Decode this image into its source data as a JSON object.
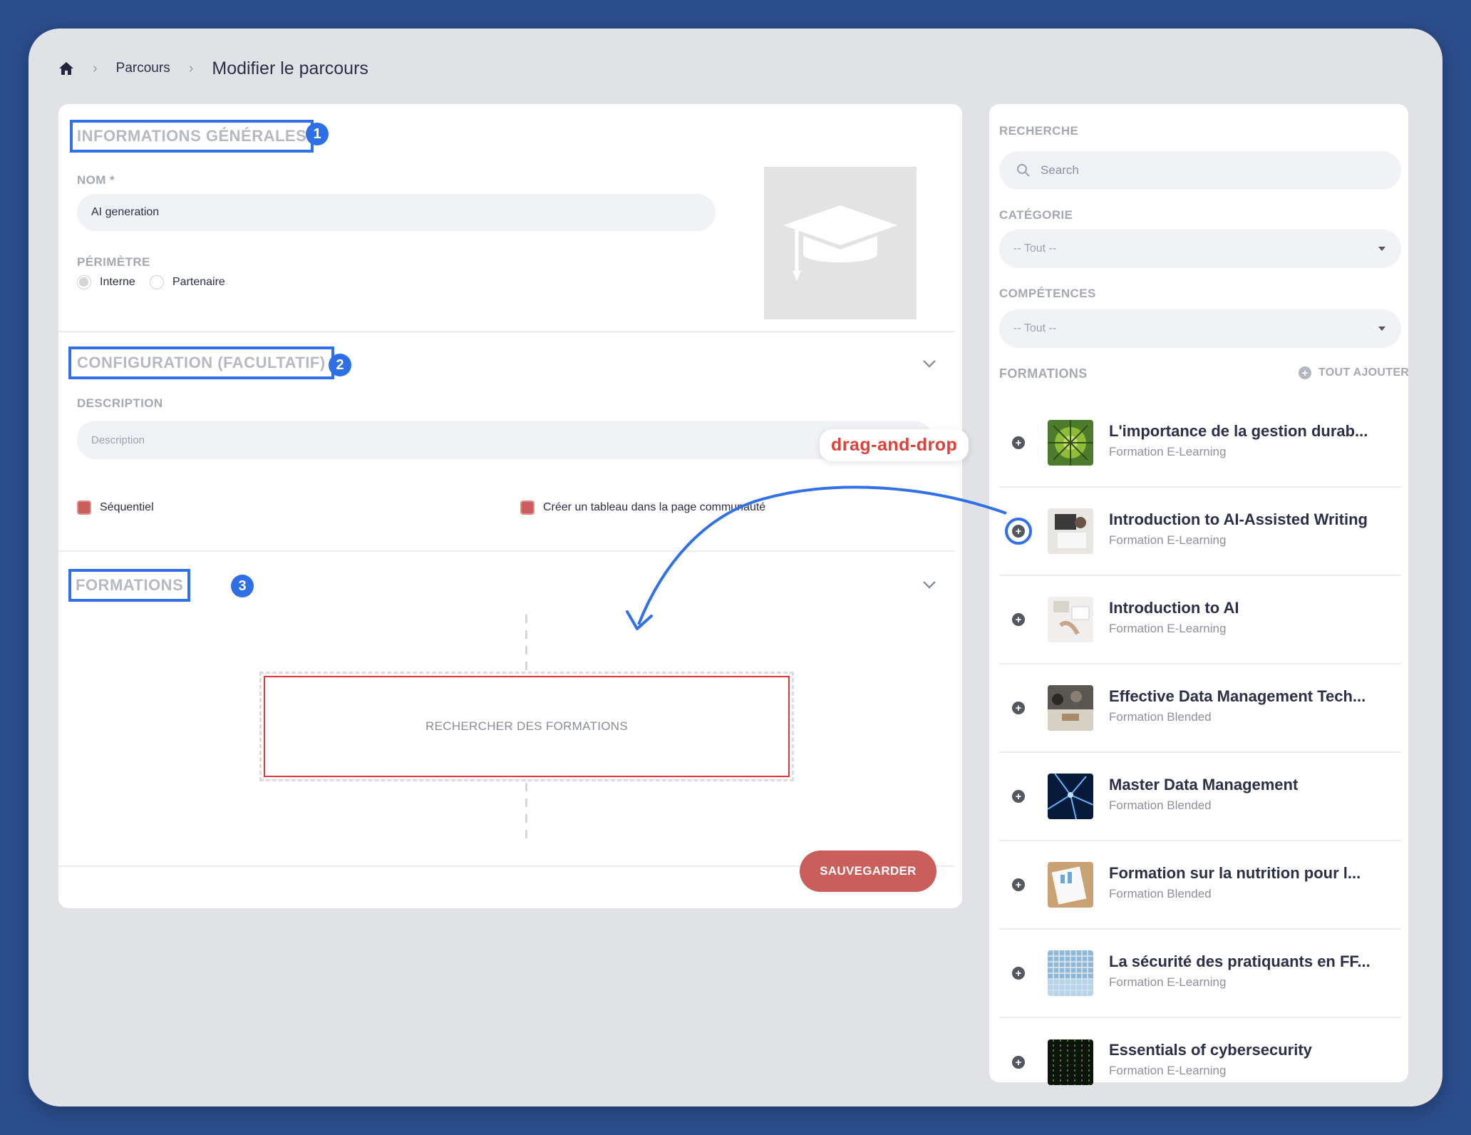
{
  "breadcrumb": {
    "home_icon": "home-icon",
    "parcours": "Parcours",
    "current": "Modifier le parcours"
  },
  "general": {
    "title": "INFORMATIONS GÉNÉRALES",
    "badge": "1",
    "nom_label": "NOM *",
    "nom_value": "AI generation",
    "perimetre_label": "PÉRIMÈTRE",
    "radio_interne": "Interne",
    "radio_partenaire": "Partenaire",
    "image_icon": "graduation-cap-icon"
  },
  "config": {
    "title": "CONFIGURATION (FACULTATIF)",
    "badge": "2",
    "description_label": "DESCRIPTION",
    "description_placeholder": "Description",
    "sequentiel": "Séquentiel",
    "tableau": "Créer un tableau dans la page communauté",
    "dnd_tag": "drag-and-drop"
  },
  "formations": {
    "title": "FORMATIONS",
    "badge": "3",
    "dropzone": "RECHERCHER DES FORMATIONS"
  },
  "save_label": "SAUVEGARDER",
  "sidebar": {
    "recherche_label": "RECHERCHE",
    "search_placeholder": "Search",
    "categorie_label": "CATÉGORIE",
    "categorie_value": "-- Tout --",
    "competences_label": "COMPÉTENCES",
    "competences_value": "-- Tout --",
    "formations_label": "FORMATIONS",
    "tout_ajouter": "TOUT AJOUTER",
    "courses": [
      {
        "title": "L'importance de la gestion durab...",
        "type": "Formation E-Learning"
      },
      {
        "title": "Introduction to AI-Assisted Writing",
        "type": "Formation E-Learning"
      },
      {
        "title": "Introduction to AI",
        "type": "Formation E-Learning"
      },
      {
        "title": "Effective Data Management Tech...",
        "type": "Formation Blended"
      },
      {
        "title": "Master Data Management",
        "type": "Formation Blended"
      },
      {
        "title": "Formation sur la nutrition pour l...",
        "type": "Formation Blended"
      },
      {
        "title": "La sécurité des pratiquants en FF...",
        "type": "Formation E-Learning"
      },
      {
        "title": "Essentials of cybersecurity",
        "type": "Formation E-Learning"
      }
    ]
  },
  "colors": {
    "background": "#2b4d8b",
    "highlight_blue": "#3070e8",
    "save_button": "#c95e5b",
    "dropzone_border": "#e6343a",
    "dnd_text": "#e0403a"
  }
}
